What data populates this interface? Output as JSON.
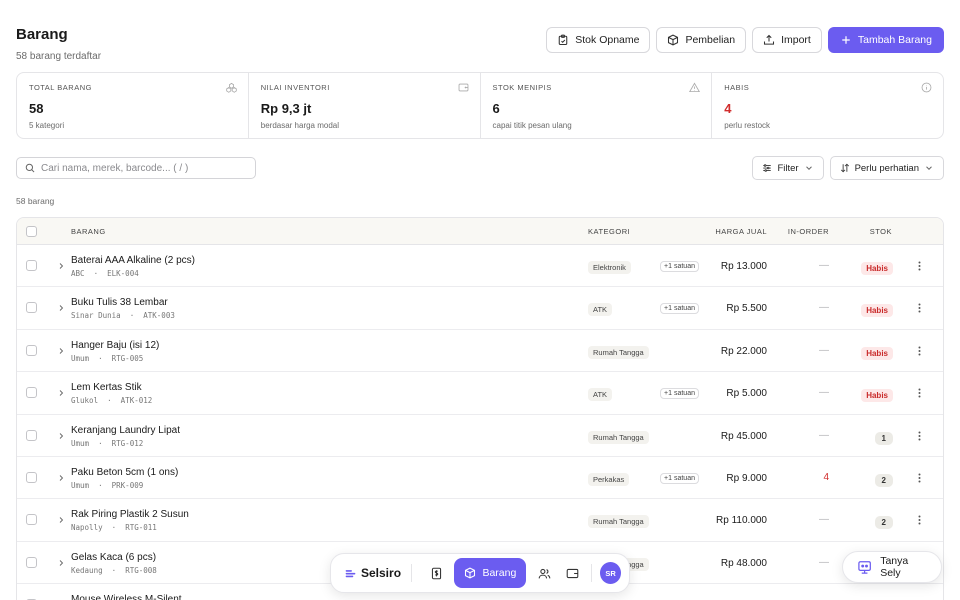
{
  "page": {
    "title": "Barang",
    "subtitle": "58 barang terdaftar"
  },
  "actions": {
    "stok_opname": "Stok Opname",
    "pembelian": "Pembelian",
    "import": "Import",
    "tambah": "Tambah Barang"
  },
  "stats": [
    {
      "label": "TOTAL BARANG",
      "value": "58",
      "sub": "5 kategori",
      "icon": "boxes-icon"
    },
    {
      "label": "NILAI INVENTORI",
      "value": "Rp 9,3 jt",
      "sub": "berdasar harga modal",
      "icon": "wallet-icon"
    },
    {
      "label": "STOK MENIPIS",
      "value": "6",
      "sub": "capai titik pesan ulang",
      "icon": "alert-triangle-icon"
    },
    {
      "label": "HABIS",
      "value": "4",
      "sub": "perlu restock",
      "icon": "info-icon"
    }
  ],
  "search": {
    "placeholder": "Cari nama, merek, barcode...  ( / )"
  },
  "filters": {
    "filter": "Filter",
    "sort": "Perlu perhatian"
  },
  "list_count": "58 barang",
  "table": {
    "headers": {
      "barang": "BARANG",
      "kategori": "KATEGORI",
      "harga": "HARGA JUAL",
      "inorder": "IN-ORDER",
      "stok": "STOK"
    },
    "rows": [
      {
        "name": "Baterai AAA Alkaline (2 pcs)",
        "brand": "ABC",
        "sku": "ELK-004",
        "category": "Elektronik",
        "unit": "+1 satuan",
        "price": "Rp 13.000",
        "inorder": "—",
        "stock": "Habis"
      },
      {
        "name": "Buku Tulis 38 Lembar",
        "brand": "Sinar Dunia",
        "sku": "ATK-003",
        "category": "ATK",
        "unit": "+1 satuan",
        "price": "Rp 5.500",
        "inorder": "—",
        "stock": "Habis"
      },
      {
        "name": "Hanger Baju (isi 12)",
        "brand": "Umum",
        "sku": "RTG-005",
        "category": "Rumah Tangga",
        "unit": "",
        "price": "Rp 22.000",
        "inorder": "—",
        "stock": "Habis"
      },
      {
        "name": "Lem Kertas Stik",
        "brand": "Glukol",
        "sku": "ATK-012",
        "category": "ATK",
        "unit": "+1 satuan",
        "price": "Rp 5.000",
        "inorder": "—",
        "stock": "Habis"
      },
      {
        "name": "Keranjang Laundry Lipat",
        "brand": "Umum",
        "sku": "RTG-012",
        "category": "Rumah Tangga",
        "unit": "",
        "price": "Rp 45.000",
        "inorder": "—",
        "stock": "1"
      },
      {
        "name": "Paku Beton 5cm (1 ons)",
        "brand": "Umum",
        "sku": "PRK-009",
        "category": "Perkakas",
        "unit": "+1 satuan",
        "price": "Rp 9.000",
        "inorder": "4",
        "stock": "2"
      },
      {
        "name": "Rak Piring Plastik 2 Susun",
        "brand": "Napolly",
        "sku": "RTG-011",
        "category": "Rumah Tangga",
        "unit": "",
        "price": "Rp 110.000",
        "inorder": "—",
        "stock": "2"
      },
      {
        "name": "Gelas Kaca (6 pcs)",
        "brand": "Kedaung",
        "sku": "RTG-008",
        "category": "Rumah Tangga",
        "unit": "",
        "price": "Rp 48.000",
        "inorder": "—",
        "stock": ""
      },
      {
        "name": "Mouse Wireless M-Silent",
        "brand": "",
        "sku": "",
        "category": "",
        "unit": "",
        "price": "",
        "inorder": "",
        "stock": ""
      }
    ]
  },
  "nav": {
    "brand": "Selsiro",
    "active": "Barang",
    "avatar": "SR"
  },
  "assistant": {
    "label": "Tanya Sely"
  },
  "colors": {
    "accent": "#6b5cf0",
    "danger": "#d12d2d"
  }
}
